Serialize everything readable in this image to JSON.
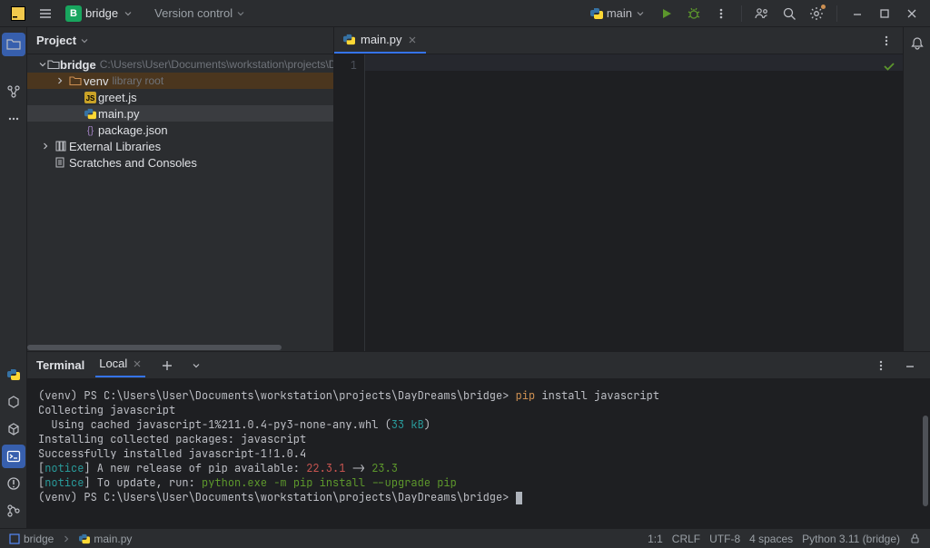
{
  "titlebar": {
    "project_letter": "B",
    "project_name": "bridge",
    "vcs_label": "Version control",
    "run_config": "main"
  },
  "project": {
    "header": "Project",
    "root": "bridge",
    "root_path": "C:\\Users\\User\\Documents\\workstation\\projects\\DayDrea",
    "venv": "venv",
    "venv_sub": "library root",
    "files": {
      "greet": "greet.js",
      "main": "main.py",
      "package": "package.json"
    },
    "external": "External Libraries",
    "scratches": "Scratches and Consoles"
  },
  "editor": {
    "tab_name": "main.py",
    "line_number": "1"
  },
  "terminal": {
    "title": "Terminal",
    "tab": "Local",
    "lines": [
      {
        "segments": [
          {
            "text": "(venv) PS C:\\Users\\User\\Documents\\workstation\\projects\\DayDreams\\bridge> ",
            "cls": "c-prompt"
          },
          {
            "text": "pip ",
            "cls": "c-cmd"
          },
          {
            "text": "install javascript",
            "cls": ""
          }
        ]
      },
      {
        "segments": [
          {
            "text": "Collecting javascript",
            "cls": ""
          }
        ]
      },
      {
        "segments": [
          {
            "text": "  Using cached javascript-1%211.0.4-py3-none-any.whl ",
            "cls": ""
          },
          {
            "text": "(",
            "cls": ""
          },
          {
            "text": "33 kB",
            "cls": "c-cyan"
          },
          {
            "text": ")",
            "cls": ""
          }
        ]
      },
      {
        "segments": [
          {
            "text": "Installing collected packages: javascript",
            "cls": ""
          }
        ]
      },
      {
        "segments": [
          {
            "text": "Successfully installed javascript-1!1.0.4",
            "cls": ""
          }
        ]
      },
      {
        "segments": [
          {
            "text": "",
            "cls": ""
          }
        ]
      },
      {
        "segments": [
          {
            "text": "[",
            "cls": ""
          },
          {
            "text": "notice",
            "cls": "c-cyan"
          },
          {
            "text": "] A new release of pip available: ",
            "cls": ""
          },
          {
            "text": "22.3.1",
            "cls": "c-red"
          },
          {
            "text": " -> ",
            "cls": ""
          },
          {
            "text": "23.3",
            "cls": "c-green"
          }
        ]
      },
      {
        "segments": [
          {
            "text": "[",
            "cls": ""
          },
          {
            "text": "notice",
            "cls": "c-cyan"
          },
          {
            "text": "] To update, run: ",
            "cls": ""
          },
          {
            "text": "python.exe -m pip install --upgrade pip",
            "cls": "c-green"
          }
        ]
      },
      {
        "segments": [
          {
            "text": "(venv) PS C:\\Users\\User\\Documents\\workstation\\projects\\DayDreams\\bridge> ",
            "cls": "c-prompt"
          }
        ],
        "cursor": true
      }
    ]
  },
  "statusbar": {
    "container": "bridge",
    "breadcrumb_file": "main.py",
    "pos": "1:1",
    "line_sep": "CRLF",
    "encoding": "UTF-8",
    "indent": "4 spaces",
    "interpreter": "Python 3.11 (bridge)"
  }
}
